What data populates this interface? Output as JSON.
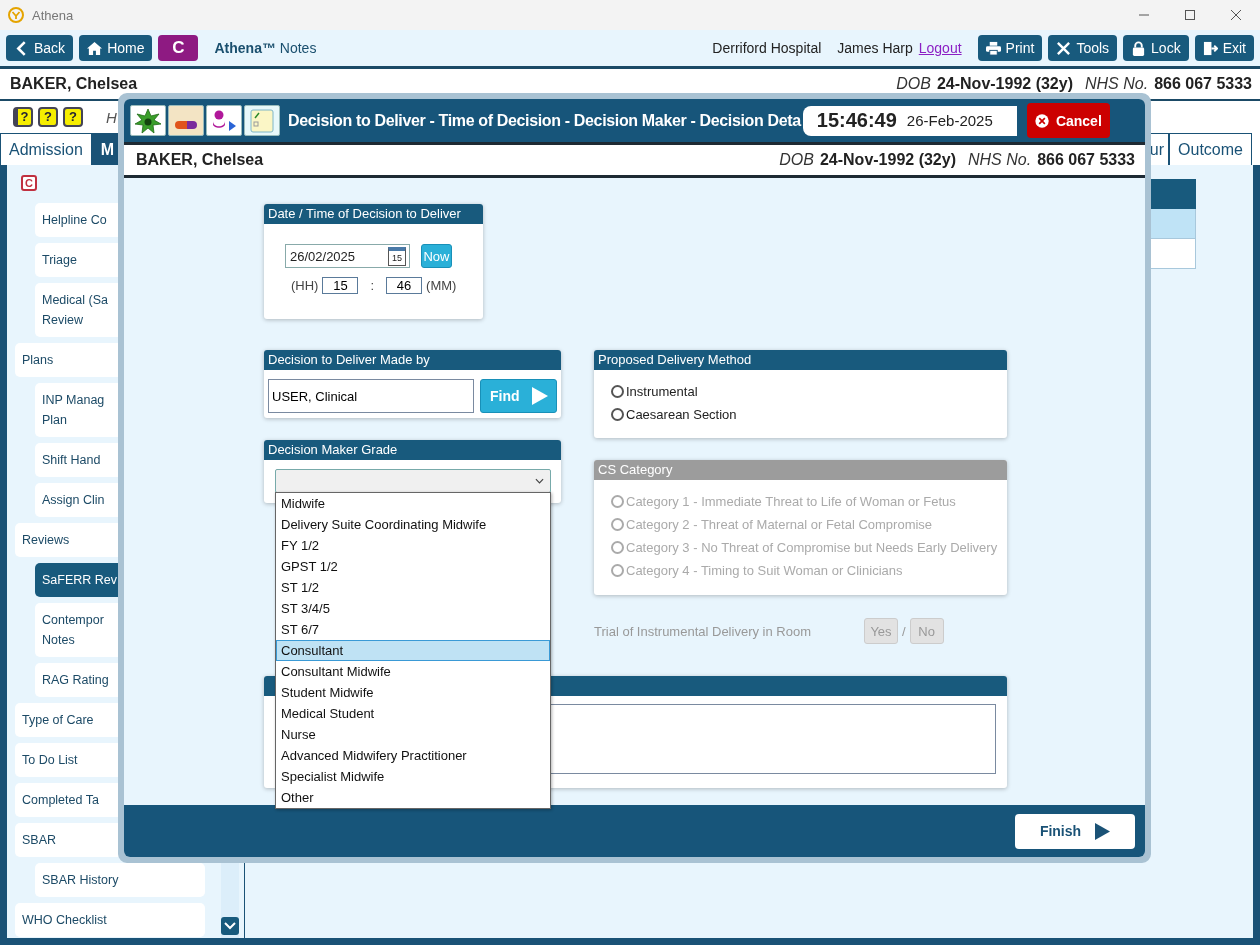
{
  "window": {
    "title": "Athena"
  },
  "toolbar": {
    "nav": [
      {
        "label": "Back"
      },
      {
        "label": "Home"
      }
    ],
    "badge": "C",
    "app_name": "Athena™",
    "app_section": "Notes",
    "hospital": "Derriford Hospital",
    "user": "James Harp",
    "logout": "Logout",
    "actions": [
      {
        "label": "Print"
      },
      {
        "label": "Tools"
      },
      {
        "label": "Lock"
      },
      {
        "label": "Exit"
      }
    ]
  },
  "patient": {
    "name": "BAKER, Chelsea",
    "dob_label": "DOB",
    "dob": "24-Nov-1992 (32y)",
    "nhs_label": "NHS No.",
    "nhs": "866 067 5333"
  },
  "help_icons": [
    "?",
    "?",
    "?"
  ],
  "hint": "H",
  "tabs": [
    {
      "label": "Admission",
      "selected": false
    },
    {
      "label": "M",
      "selected": true
    },
    {
      "label": "ur",
      "selected": false
    },
    {
      "label": "Outcome",
      "selected": false
    }
  ],
  "sidebar": {
    "items": [
      {
        "label": "C",
        "kind": "badge",
        "selected": false,
        "children": [
          {
            "label": "Helpline Co",
            "selected": false
          },
          {
            "label": "Triage",
            "selected": false
          },
          {
            "label": "Medical (Sa\nReview",
            "selected": false
          }
        ]
      },
      {
        "label": "Plans",
        "kind": "item",
        "selected": false,
        "children": [
          {
            "label": "INP Manag\nPlan",
            "selected": false
          },
          {
            "label": "Shift Hand",
            "selected": false
          },
          {
            "label": "Assign Clin",
            "selected": false
          }
        ]
      },
      {
        "label": "Reviews",
        "kind": "item",
        "selected": false,
        "children": [
          {
            "label": "SaFERR Rev",
            "selected": true
          },
          {
            "label": "Contempor\nNotes",
            "selected": false
          },
          {
            "label": "RAG Rating",
            "selected": false
          }
        ]
      },
      {
        "label": "Type of Care",
        "kind": "item",
        "selected": false
      },
      {
        "label": "To Do List",
        "kind": "item",
        "selected": false
      },
      {
        "label": "Completed Ta",
        "kind": "item",
        "selected": false
      },
      {
        "label": "SBAR",
        "kind": "item",
        "selected": false,
        "children": [
          {
            "label": "SBAR History",
            "selected": false
          }
        ]
      },
      {
        "label": "WHO Checklist",
        "kind": "item",
        "selected": false
      }
    ]
  },
  "dialog": {
    "title": "Decision to Deliver - Time of Decision - Decision Maker - Decision Deta",
    "clock": {
      "time": "15:46:49",
      "date": "26-Feb-2025"
    },
    "cancel": "Cancel",
    "patient": {
      "name": "BAKER, Chelsea",
      "dob_label": "DOB",
      "dob": "24-Nov-1992 (32y)",
      "nhs_label": "NHS No.",
      "nhs": "866 067 5333"
    },
    "decision_time": {
      "heading": "Date / Time of Decision to Deliver",
      "date": "26/02/2025",
      "calendar_day": "15",
      "now": "Now",
      "hh_label": "(HH)",
      "hh": "15",
      "separator": ":",
      "mm": "46",
      "mm_label": "(MM)"
    },
    "made_by": {
      "heading": "Decision to Deliver Made by",
      "value": "USER, Clinical",
      "find": "Find"
    },
    "grade": {
      "heading": "Decision Maker Grade",
      "expanded": true,
      "options": [
        {
          "label": "Midwife",
          "selected": false
        },
        {
          "label": "Delivery Suite Coordinating Midwife",
          "selected": false
        },
        {
          "label": "FY 1/2",
          "selected": false
        },
        {
          "label": "GPST 1/2",
          "selected": false
        },
        {
          "label": "ST 1/2",
          "selected": false
        },
        {
          "label": "ST 3/4/5",
          "selected": false
        },
        {
          "label": "ST 6/7",
          "selected": false
        },
        {
          "label": "Consultant",
          "selected": true
        },
        {
          "label": "Consultant Midwife",
          "selected": false
        },
        {
          "label": "Student Midwife",
          "selected": false
        },
        {
          "label": "Medical Student",
          "selected": false
        },
        {
          "label": "Nurse",
          "selected": false
        },
        {
          "label": "Advanced Midwifery Practitioner",
          "selected": false
        },
        {
          "label": "Specialist Midwife",
          "selected": false
        },
        {
          "label": "Other",
          "selected": false
        }
      ]
    },
    "delivery_method": {
      "heading": "Proposed Delivery Method",
      "disabled": false,
      "options": [
        {
          "label": "Instrumental",
          "checked": false
        },
        {
          "label": "Caesarean Section",
          "checked": false
        }
      ]
    },
    "cs_category": {
      "heading": "CS Category",
      "disabled": true,
      "options": [
        {
          "label": "Category 1 - Immediate Threat to Life of Woman or Fetus",
          "checked": false
        },
        {
          "label": "Category 2 - Threat of Maternal or Fetal Compromise",
          "checked": false
        },
        {
          "label": "Category 3 - No Threat of Compromise but Needs Early Delivery",
          "checked": false
        },
        {
          "label": "Category 4 - Timing to Suit Woman or Clinicians",
          "checked": false
        }
      ]
    },
    "trial": {
      "label": "Trial of Instrumental Delivery in Room",
      "disabled": true,
      "yes": "Yes",
      "separator": "/",
      "no": "No"
    },
    "finish": "Finish"
  }
}
